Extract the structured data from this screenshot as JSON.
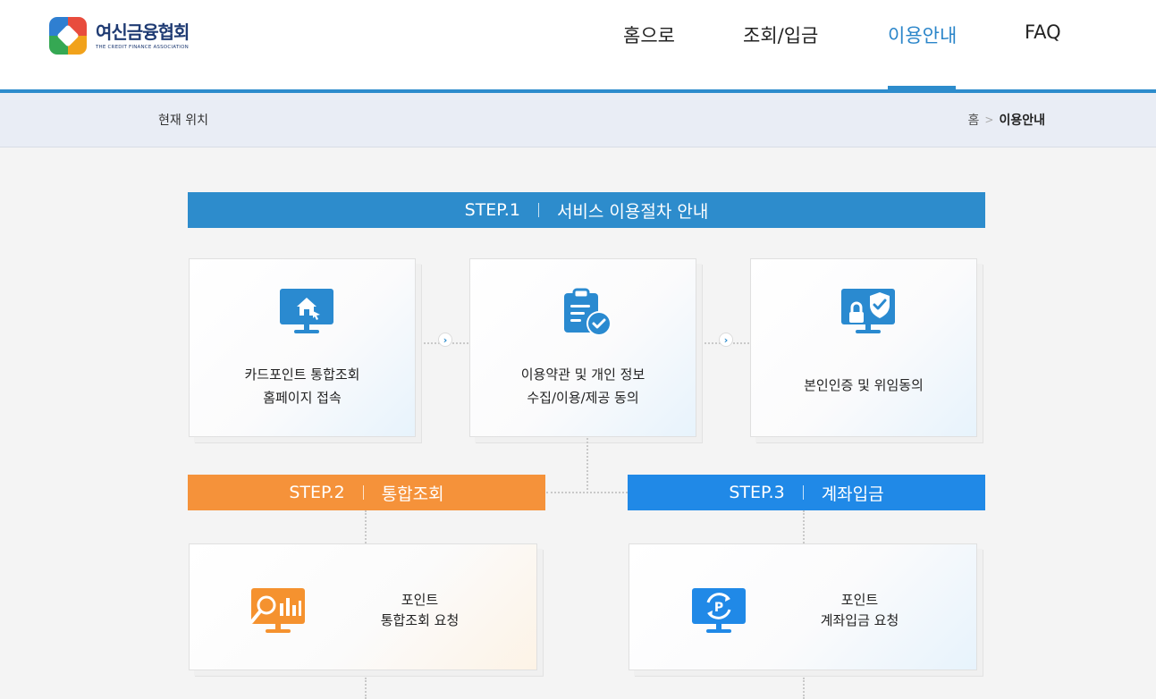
{
  "logo": {
    "name_ko": "여신금융협회",
    "name_en": "THE CREDIT FINANCE ASSOCIATION"
  },
  "nav": {
    "items": [
      {
        "label": "홈으로"
      },
      {
        "label": "조회/입금"
      },
      {
        "label": "이용안내",
        "active": true
      },
      {
        "label": "FAQ"
      }
    ]
  },
  "breadcrumb": {
    "label": "현재 위치",
    "home": "홈",
    "separator": ">",
    "current": "이용안내"
  },
  "steps": {
    "step1": {
      "step": "STEP.1",
      "title": "서비스 이용절차 안내"
    },
    "step2": {
      "step": "STEP.2",
      "title": "통합조회"
    },
    "step3": {
      "step": "STEP.3",
      "title": "계좌입금"
    }
  },
  "cards": {
    "c1": {
      "line1": "카드포인트 통합조회",
      "line2": "홈페이지 접속",
      "icon": "monitor-home-icon"
    },
    "c2": {
      "line1": "이용약관 및 개인 정보",
      "line2": "수집/이용/제공 동의",
      "icon": "clipboard-check-icon"
    },
    "c3": {
      "line1": "본인인증 및 위임동의",
      "icon": "monitor-lock-shield-icon"
    },
    "c4": {
      "line1": "포인트",
      "line2": "통합조회 요청",
      "icon": "monitor-search-chart-icon"
    },
    "c5": {
      "line1": "포인트",
      "line2": "계좌입금 요청",
      "icon": "monitor-point-transfer-icon"
    }
  },
  "colors": {
    "primary_blue": "#2d8ccc",
    "step2_orange": "#f5923a",
    "step3_blue": "#2089e7",
    "icon_blue": "#2a8ad0",
    "icon_orange": "#f5922f"
  }
}
